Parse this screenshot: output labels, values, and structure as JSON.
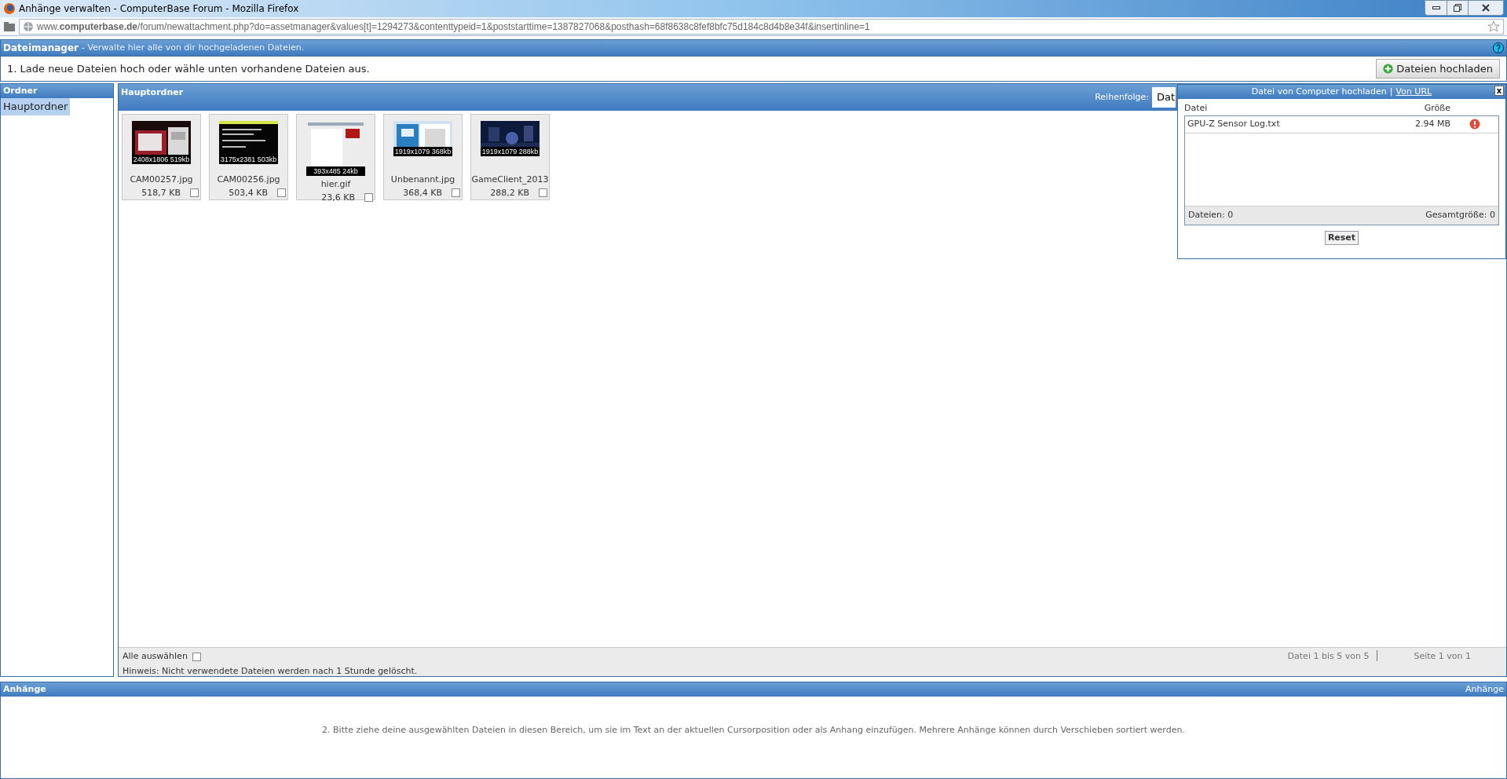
{
  "window": {
    "title": "Anhänge verwalten - ComputerBase Forum - Mozilla Firefox"
  },
  "address_bar": {
    "url": "www.**computerbase.de**/forum/newattachment.php?do=assetmanager&values[t]=1294273&contenttypeid=1&poststarttime=1387827068&posthash=68f8638c8fef8bfc75d184c8d4b8e34f&insertinline=1"
  },
  "file_manager": {
    "title": "Dateimanager",
    "subtitle": "- Verwalte hier alle von dir hochgeladenen Dateien.",
    "instruction": "1. Lade neue Dateien hoch oder wähle unten vorhandene Dateien aus.",
    "upload_button": "Dateien hochladen"
  },
  "folders": {
    "title": "Ordner",
    "items": [
      {
        "label": "Hauptordner",
        "selected": true
      }
    ]
  },
  "main": {
    "title": "Hauptordner",
    "sort_label": "Reihenfolge:",
    "sort_value": "Dat",
    "files": [
      {
        "name": "CAM00257.jpg",
        "size": "518,7 KB",
        "info": "2408x1806 519kb",
        "checked": false
      },
      {
        "name": "CAM00256.jpg",
        "size": "503,4 KB",
        "info": "3175x2381 503kb",
        "checked": false,
        "kind": "console"
      },
      {
        "name": "hier.gif",
        "size": "23,6 KB",
        "info": "393x485 24kb",
        "checked": false,
        "kind": "tall"
      },
      {
        "name": "Unbenannt.jpg",
        "size": "368,4 KB",
        "info": "1919x1079 368kb",
        "checked": false,
        "kind": "desktop"
      },
      {
        "name": "GameClient_2013",
        "size": "288,2 KB",
        "info": "1919x1079 288kb",
        "checked": false,
        "kind": "game"
      }
    ],
    "select_all": {
      "label": "Alle auswählen",
      "checked": false
    },
    "hint": "Hinweis: Nicht verwendete Dateien werden nach 1 Stunde gelöscht.",
    "range": "Datei 1 bis 5 von 5",
    "page": "Seite 1 von 1"
  },
  "upload_popup": {
    "title": "Datei von Computer hochladen",
    "separator": "|",
    "link": "Von URL",
    "close": "x",
    "columns": [
      "Datei",
      "Größe"
    ],
    "rows": [
      {
        "name": "GPU-Z Sensor Log.txt",
        "size": "2.94 MB",
        "error": true
      }
    ],
    "files_count": "Dateien: 0",
    "total_size": "Gesamtgröße: 0",
    "reset": "Reset"
  },
  "attachments": {
    "title": "Anhänge",
    "right_label": "Anhänge",
    "instruction": "2. Bitte ziehe deine ausgewählten Dateien in diesen Bereich, um sie im Text an der aktuellen Cursorposition oder als Anhang einzufügen. Mehrere Anhänge können durch Verschieben sortiert werden."
  }
}
